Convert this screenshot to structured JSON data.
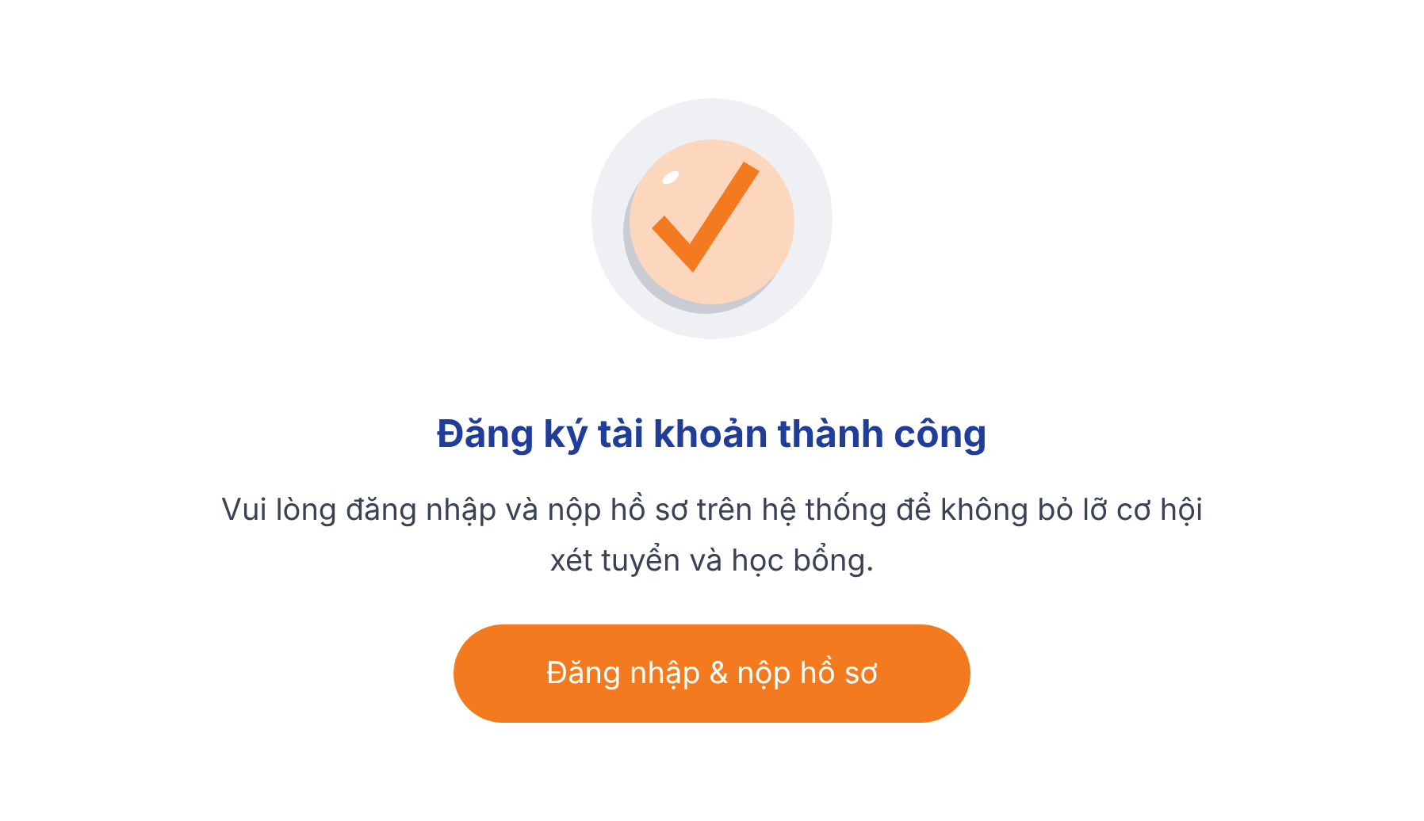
{
  "title": "Đăng ký tài khoản thành công",
  "message": "Vui lòng đăng nhập và nộp hồ sơ trên hệ thống để không bỏ lỡ cơ hội xét tuyển và học bổng.",
  "button": "Đăng nhập & nộp hồ sơ"
}
